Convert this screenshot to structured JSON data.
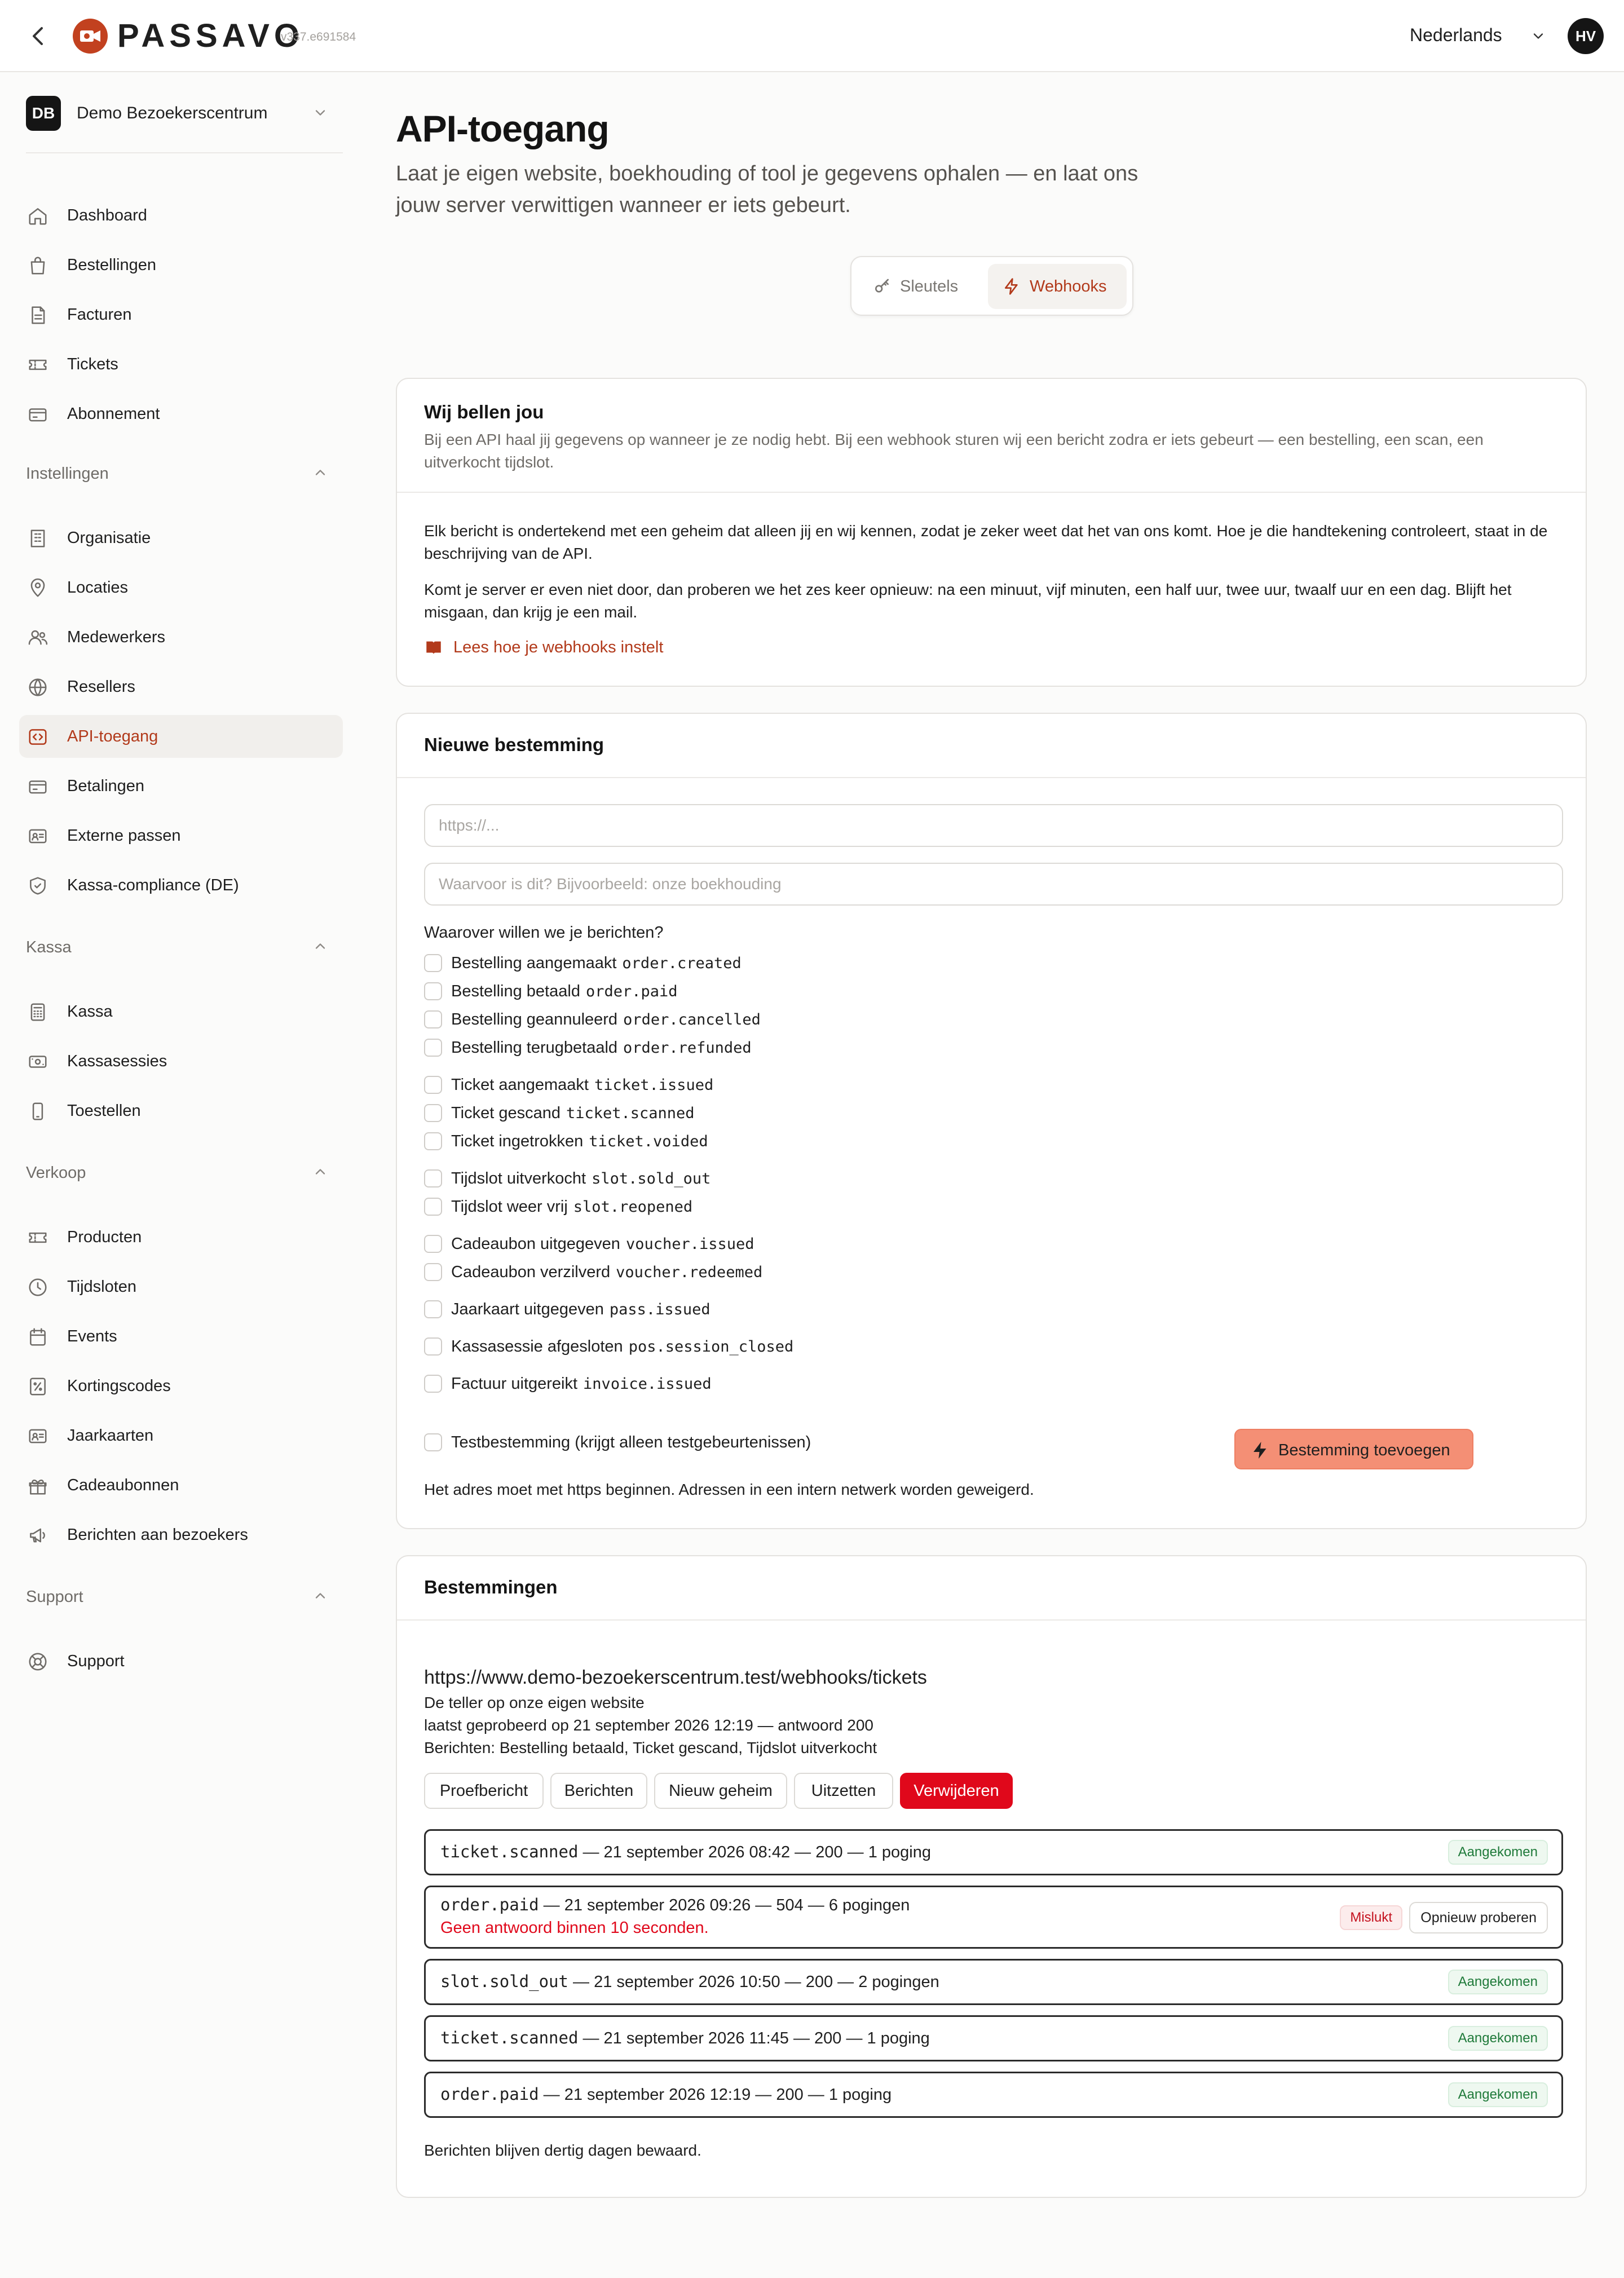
{
  "app": {
    "brand": "PASSAVO",
    "version": "v337.e691584",
    "language": "Nederlands",
    "user_initials": "HV"
  },
  "org": {
    "initials": "DB",
    "name": "Demo Bezoekerscentrum"
  },
  "sidebar": {
    "main_items": [
      {
        "label": "Dashboard",
        "icon": "home-icon"
      },
      {
        "label": "Bestellingen",
        "icon": "shopping-bag-icon"
      },
      {
        "label": "Facturen",
        "icon": "invoice-icon"
      },
      {
        "label": "Tickets",
        "icon": "ticket-icon"
      },
      {
        "label": "Abonnement",
        "icon": "credit-card-icon"
      }
    ],
    "sections": [
      {
        "label": "Instellingen",
        "items": [
          {
            "label": "Organisatie",
            "icon": "building-icon"
          },
          {
            "label": "Locaties",
            "icon": "map-pin-icon"
          },
          {
            "label": "Medewerkers",
            "icon": "users-icon"
          },
          {
            "label": "Resellers",
            "icon": "globe-icon"
          },
          {
            "label": "API-toegang",
            "icon": "code-icon",
            "active": true
          },
          {
            "label": "Betalingen",
            "icon": "credit-card-icon"
          },
          {
            "label": "Externe passen",
            "icon": "id-card-icon"
          },
          {
            "label": "Kassa-compliance (DE)",
            "icon": "shield-icon"
          }
        ]
      },
      {
        "label": "Kassa",
        "items": [
          {
            "label": "Kassa",
            "icon": "calculator-icon"
          },
          {
            "label": "Kassasessies",
            "icon": "cash-icon"
          },
          {
            "label": "Toestellen",
            "icon": "smartphone-icon"
          }
        ]
      },
      {
        "label": "Verkoop",
        "items": [
          {
            "label": "Producten",
            "icon": "ticket-icon"
          },
          {
            "label": "Tijdsloten",
            "icon": "clock-icon"
          },
          {
            "label": "Events",
            "icon": "calendar-icon"
          },
          {
            "label": "Kortingscodes",
            "icon": "percent-icon"
          },
          {
            "label": "Jaarkaarten",
            "icon": "id-card-icon"
          },
          {
            "label": "Cadeaubonnen",
            "icon": "gift-icon"
          },
          {
            "label": "Berichten aan bezoekers",
            "icon": "megaphone-icon"
          }
        ]
      },
      {
        "label": "Support",
        "items": [
          {
            "label": "Support",
            "icon": "lifebuoy-icon"
          }
        ]
      }
    ]
  },
  "page": {
    "title": "API-toegang",
    "subtitle": "Laat je eigen website, boekhouding of tool je gegevens ophalen — en laat ons jouw server verwittigen wanneer er iets gebeurt.",
    "tabs": [
      {
        "label": "Sleutels",
        "icon": "key-icon"
      },
      {
        "label": "Webhooks",
        "icon": "lightning-icon",
        "active": true
      }
    ]
  },
  "intro": {
    "title": "Wij bellen jou",
    "lead": "Bij een API haal jij gegevens op wanneer je ze nodig hebt. Bij een webhook sturen wij een bericht zodra er iets gebeurt — een bestelling, een scan, een uitverkocht tijdslot.",
    "p1": "Elk bericht is ondertekend met een geheim dat alleen jij en wij kennen, zodat je zeker weet dat het van ons komt. Hoe je die handtekening controleert, staat in de beschrijving van de API.",
    "p2": "Komt je server er even niet door, dan proberen we het zes keer opnieuw: na een minuut, vijf minuten, een half uur, twee uur, twaalf uur en een dag. Blijft het misgaan, dan krijg je een mail.",
    "link": "Lees hoe je webhooks instelt"
  },
  "new_destination": {
    "title": "Nieuwe bestemming",
    "url_placeholder": "https://...",
    "desc_placeholder": "Waarvoor is dit? Bijvoorbeeld: onze boekhouding",
    "question": "Waarover willen we je berichten?",
    "events": [
      {
        "label": "Bestelling aangemaakt",
        "code": "order.created"
      },
      {
        "label": "Bestelling betaald",
        "code": "order.paid"
      },
      {
        "label": "Bestelling geannuleerd",
        "code": "order.cancelled"
      },
      {
        "label": "Bestelling terugbetaald",
        "code": "order.refunded"
      },
      {
        "label": "Ticket aangemaakt",
        "code": "ticket.issued"
      },
      {
        "label": "Ticket gescand",
        "code": "ticket.scanned"
      },
      {
        "label": "Ticket ingetrokken",
        "code": "ticket.voided"
      },
      {
        "label": "Tijdslot uitverkocht",
        "code": "slot.sold_out"
      },
      {
        "label": "Tijdslot weer vrij",
        "code": "slot.reopened"
      },
      {
        "label": "Cadeaubon uitgegeven",
        "code": "voucher.issued"
      },
      {
        "label": "Cadeaubon verzilverd",
        "code": "voucher.redeemed"
      },
      {
        "label": "Jaarkaart uitgegeven",
        "code": "pass.issued"
      },
      {
        "label": "Kassasessie afgesloten",
        "code": "pos.session_closed"
      },
      {
        "label": "Factuur uitgereikt",
        "code": "invoice.issued"
      }
    ],
    "test_label": "Testbestemming (krijgt alleen testgebeurtenissen)",
    "add_button": "Bestemming toevoegen",
    "note": "Het adres moet met https beginnen. Adressen in een intern netwerk worden geweigerd."
  },
  "destinations": {
    "title": "Bestemmingen",
    "url": "https://www.demo-bezoekerscentrum.test/webhooks/tickets",
    "description": "De teller op onze eigen website",
    "last_tried": "laatst geprobeerd op 21 september 2026 12:19 — antwoord 200",
    "subscribed": "Berichten: Bestelling betaald, Ticket gescand, Tijdslot uitverkocht",
    "buttons": {
      "test": "Proefbericht",
      "messages": "Berichten",
      "new_secret": "Nieuw geheim",
      "disable": "Uitzetten",
      "delete": "Verwijderen"
    },
    "deliveries": [
      {
        "event": "ticket.scanned",
        "detail": " — 21 september 2026 08:42 — 200 — 1 poging",
        "status": "Aangekomen"
      },
      {
        "event": "order.paid",
        "detail": " — 21 september 2026 09:26 — 504 — 6 pogingen",
        "status": "Mislukt",
        "error": "Geen antwoord binnen 10 seconden.",
        "retry": "Opnieuw proberen"
      },
      {
        "event": "slot.sold_out",
        "detail": " — 21 september 2026 10:50 — 200 — 2 pogingen",
        "status": "Aangekomen"
      },
      {
        "event": "ticket.scanned",
        "detail": " — 21 september 2026 11:45 — 200 — 1 poging",
        "status": "Aangekomen"
      },
      {
        "event": "order.paid",
        "detail": " — 21 september 2026 12:19 — 200 — 1 poging",
        "status": "Aangekomen"
      }
    ],
    "retention_note": "Berichten blijven dertig dagen bewaard."
  }
}
